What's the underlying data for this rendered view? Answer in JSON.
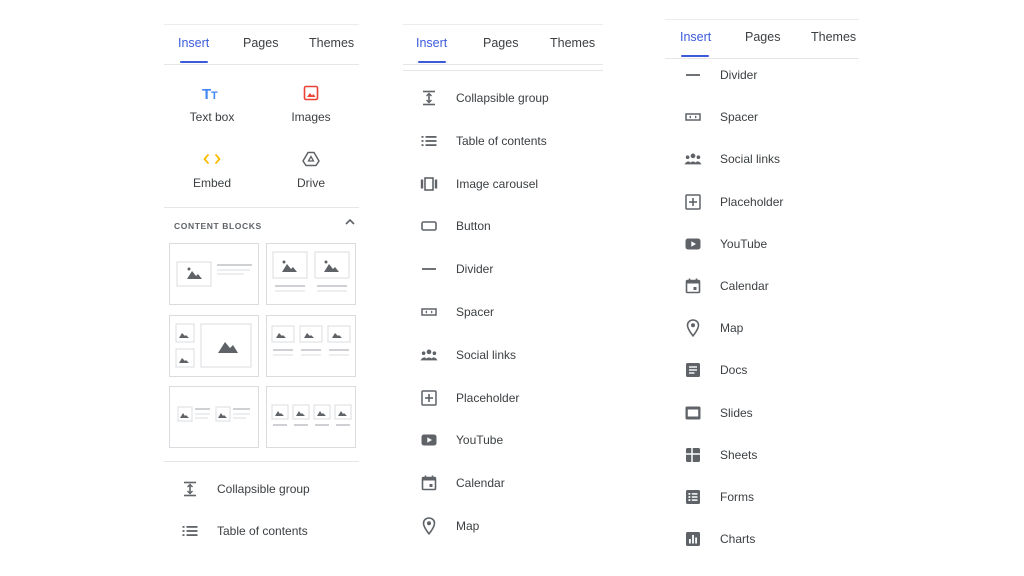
{
  "panel1": {
    "tabs": [
      "Insert",
      "Pages",
      "Themes"
    ],
    "insert_items": [
      {
        "label": "Text box",
        "icon": "text-box-icon",
        "color": "#4285f4"
      },
      {
        "label": "Images",
        "icon": "image-icon",
        "color": "#ea4335"
      },
      {
        "label": "Embed",
        "icon": "embed-icon",
        "color": "#fbbc04"
      },
      {
        "label": "Drive",
        "icon": "drive-icon",
        "color": "#5f6368"
      }
    ],
    "section_title": "CONTENT BLOCKS",
    "list_items": [
      {
        "label": "Collapsible group",
        "icon": "collapsible-group-icon"
      },
      {
        "label": "Table of contents",
        "icon": "table-of-contents-icon"
      }
    ]
  },
  "panel2": {
    "tabs": [
      "Insert",
      "Pages",
      "Themes"
    ],
    "list_items": [
      {
        "label": "Collapsible group",
        "icon": "collapsible-group-icon"
      },
      {
        "label": "Table of contents",
        "icon": "table-of-contents-icon"
      },
      {
        "label": "Image carousel",
        "icon": "image-carousel-icon"
      },
      {
        "label": "Button",
        "icon": "button-icon"
      },
      {
        "label": "Divider",
        "icon": "divider-icon"
      },
      {
        "label": "Spacer",
        "icon": "spacer-icon"
      },
      {
        "label": "Social links",
        "icon": "social-links-icon"
      },
      {
        "label": "Placeholder",
        "icon": "placeholder-icon"
      },
      {
        "label": "YouTube",
        "icon": "youtube-icon"
      },
      {
        "label": "Calendar",
        "icon": "calendar-icon"
      },
      {
        "label": "Map",
        "icon": "map-icon"
      }
    ]
  },
  "panel3": {
    "tabs": [
      "Insert",
      "Pages",
      "Themes"
    ],
    "list_items": [
      {
        "label": "Divider",
        "icon": "divider-icon"
      },
      {
        "label": "Spacer",
        "icon": "spacer-icon"
      },
      {
        "label": "Social links",
        "icon": "social-links-icon"
      },
      {
        "label": "Placeholder",
        "icon": "placeholder-icon"
      },
      {
        "label": "YouTube",
        "icon": "youtube-icon"
      },
      {
        "label": "Calendar",
        "icon": "calendar-icon"
      },
      {
        "label": "Map",
        "icon": "map-icon"
      },
      {
        "label": "Docs",
        "icon": "docs-icon"
      },
      {
        "label": "Slides",
        "icon": "slides-icon"
      },
      {
        "label": "Sheets",
        "icon": "sheets-icon"
      },
      {
        "label": "Forms",
        "icon": "forms-icon"
      },
      {
        "label": "Charts",
        "icon": "charts-icon"
      }
    ]
  },
  "colors": {
    "accent": "#3b5bdb",
    "text": "#3c4043",
    "icon": "#5f6368",
    "border": "#dadce0"
  }
}
